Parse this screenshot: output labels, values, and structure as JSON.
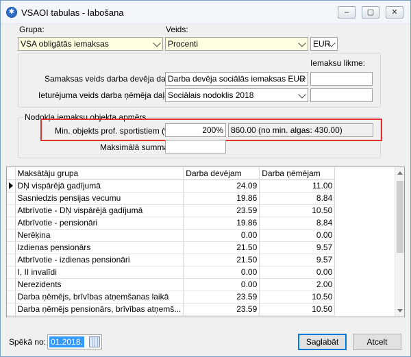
{
  "window": {
    "title": "VSAOI tabulas - labošana"
  },
  "top": {
    "grupa_label": "Grupa:",
    "grupa_value": "VSA obligātās iemaksas",
    "veids_label": "Veids:",
    "veids_value": "Procenti",
    "currency_value": "EUR",
    "likme_label": "Iemaksu likme:"
  },
  "rows": {
    "samaksas_label": "Samaksas veids darba devēja daļai:",
    "samaksas_value": "Darba devēja sociālās iemaksas EUR",
    "ieturejuma_label": "Ieturējuma veids darba ņēmēja daļai:",
    "ieturejuma_value": "Sociālais nodoklis 2018"
  },
  "nodokla": {
    "title": "Nodokļa iemaksu objekta apmērs",
    "min_label": "Min. objekts prof. sportistiem (%) :",
    "min_percent": "200%",
    "min_info": "860.00 (no min. algas: 430.00)",
    "max_label": "Maksimālā summa:"
  },
  "grid": {
    "headers": [
      "Maksātāju grupa",
      "Darba devējam",
      "Darba ņēmējam"
    ],
    "rows": [
      [
        "DŅ vispārējā gadījumā",
        "24.09",
        "11.00"
      ],
      [
        "Sasniedzis pensijas vecumu",
        "19.86",
        "8.84"
      ],
      [
        "Atbrīvotie - DŅ vispārējā gadījumā",
        "23.59",
        "10.50"
      ],
      [
        "Atbrīvotie - pensionāri",
        "19.86",
        "8.84"
      ],
      [
        "Nerēķina",
        "0.00",
        "0.00"
      ],
      [
        "Izdienas pensionārs",
        "21.50",
        "9.57"
      ],
      [
        "Atbrīvotie - izdienas pensionāri",
        "21.50",
        "9.57"
      ],
      [
        "I, II invalīdi",
        "0.00",
        "0.00"
      ],
      [
        "Nerezidents",
        "0.00",
        "2.00"
      ],
      [
        "Darba ņēmējs, brīvības atņemšanas laikā",
        "23.59",
        "10.50"
      ],
      [
        "Darba ņēmējs pensionārs, brīvības atņemš...",
        "23.59",
        "10.50"
      ]
    ]
  },
  "footer": {
    "speka_label": "Spēkā no:",
    "date_value": "01.2018.",
    "save_label": "Saglabāt",
    "cancel_label": "Atcelt"
  }
}
